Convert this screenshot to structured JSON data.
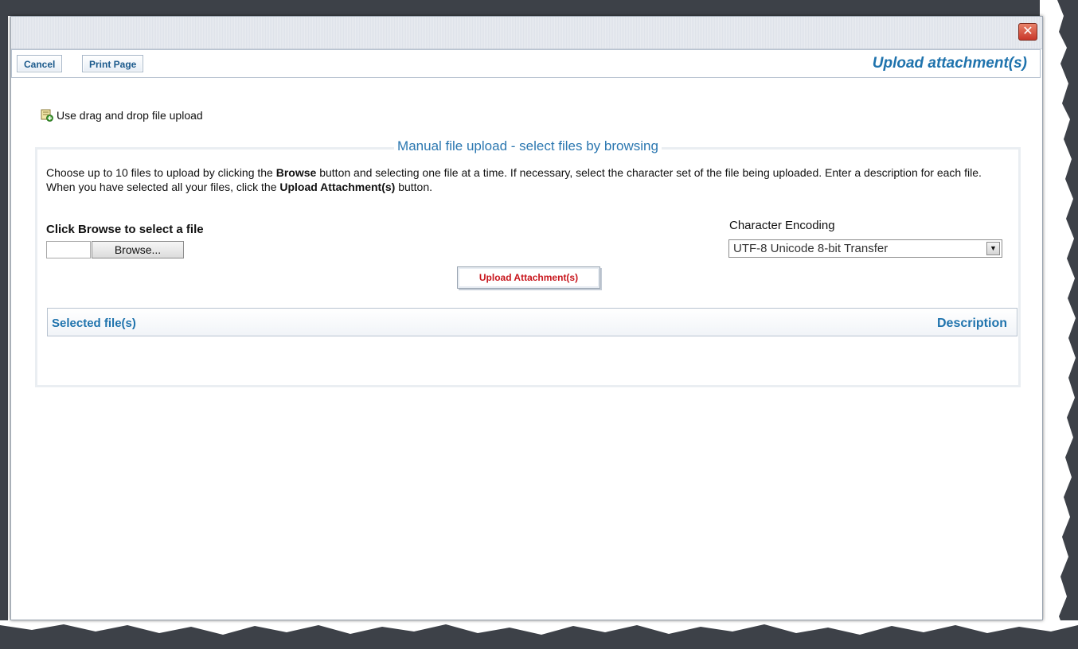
{
  "dialog": {
    "close_label": "✕"
  },
  "toolbar": {
    "cancel_label": "Cancel",
    "print_label": "Print Page",
    "title": "Upload attachment(s)"
  },
  "dnd": {
    "label": "Use drag and drop file upload",
    "icon": "file-add-icon"
  },
  "manual": {
    "legend": "Manual file upload - select files by browsing",
    "instructions_1": "Choose up to 10 files to upload by clicking the ",
    "instructions_bold_1": "Browse",
    "instructions_2": " button and selecting one file at a time. If necessary, select the character set of the file being uploaded. Enter a description for each file. When you have selected all your files, click the ",
    "instructions_bold_2": "Upload Attachment(s)",
    "instructions_3": " button.",
    "browse_prefix": "Click ",
    "browse_bold": "Browse",
    "browse_suffix": " to select a file",
    "browse_button": "Browse...",
    "encoding_label": "Character Encoding",
    "encoding_value": "UTF-8 Unicode 8-bit Transfer",
    "upload_button": "Upload Attachment(s)",
    "table_col_file": "Selected file(s)",
    "table_col_description": "Description"
  },
  "colors": {
    "accent": "#1f73ad",
    "upload_text": "#c8161d"
  }
}
